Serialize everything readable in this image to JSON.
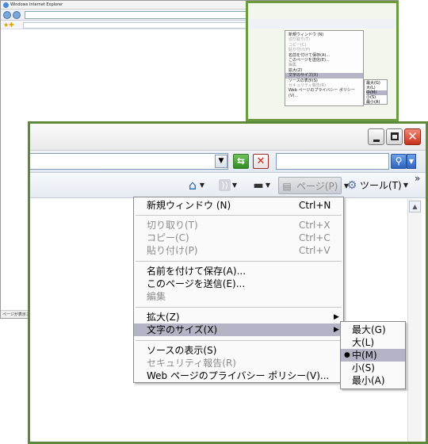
{
  "thumbnail": {
    "window_title": "Windows Internet Explorer",
    "status_text": "ページが表示されました"
  },
  "address_bar": {
    "dropdown_glyph": "▼",
    "refresh_glyph": "⇆",
    "stop_glyph": "✕",
    "search_glyph": "⚲",
    "search_dropdown_glyph": "▼"
  },
  "command_bar": {
    "home_icon": "home-icon",
    "feeds_icon": "feeds-icon",
    "print_icon": "print-icon",
    "page_label": "ページ(P)",
    "tools_label": "ツール(T)",
    "chevron": "»"
  },
  "page_menu": {
    "items": [
      {
        "label": "新規ウィンドウ (N)",
        "shortcut": "Ctrl+N"
      },
      {
        "label": "切り取り(T)",
        "shortcut": "Ctrl+X"
      },
      {
        "label": "コピー(C)",
        "shortcut": "Ctrl+C"
      },
      {
        "label": "貼り付け(P)",
        "shortcut": "Ctrl+V"
      },
      {
        "label": "名前を付けて保存(A)..."
      },
      {
        "label": "このページを送信(E)..."
      },
      {
        "label": "編集"
      },
      {
        "label": "拡大(Z)"
      },
      {
        "label": "文字のサイズ(X)"
      },
      {
        "label": "ソースの表示(S)"
      },
      {
        "label": "セキュリティ報告(R)"
      },
      {
        "label": "Web ページのプライバシー ポリシー(V)..."
      }
    ]
  },
  "text_size_submenu": {
    "items": [
      "最大(G)",
      "大(L)",
      "中(M)",
      "小(S)",
      "最小(A)"
    ],
    "selected": "中(M)"
  },
  "colors": {
    "highlight_border": "#5c8a3a",
    "menu_selection": "#b4b4c6"
  }
}
